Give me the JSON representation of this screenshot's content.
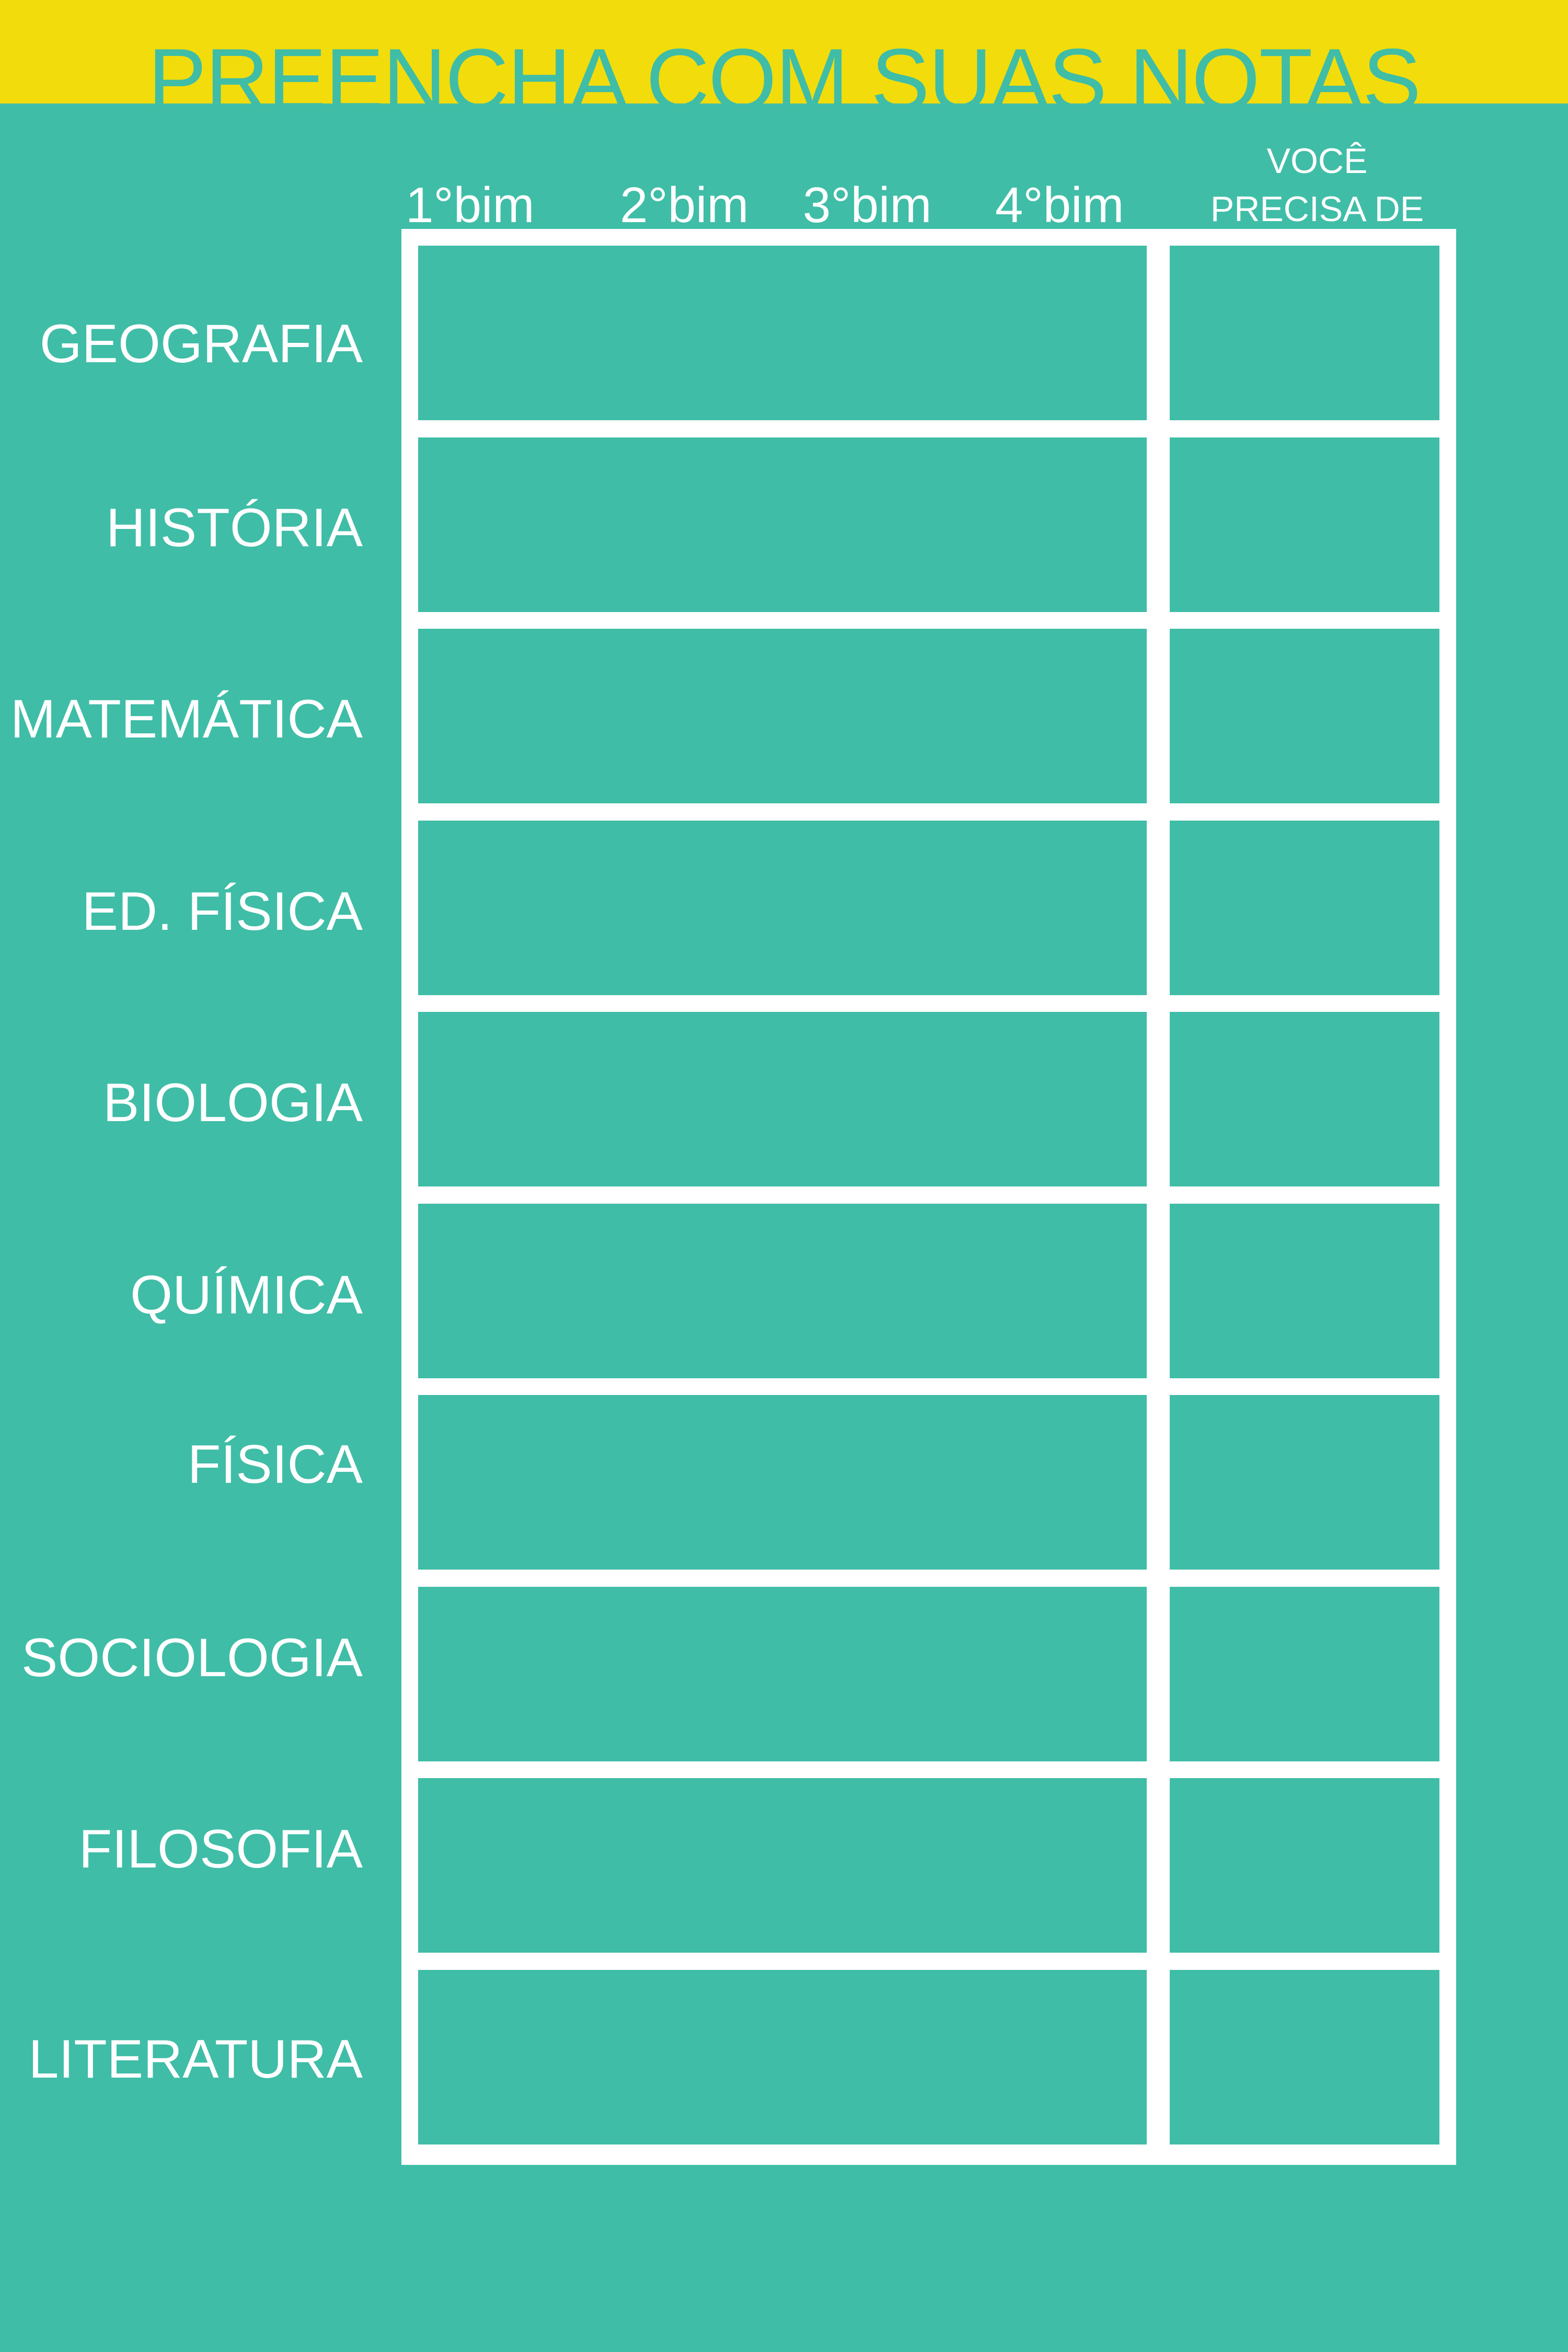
{
  "header": {
    "title": "PREENCHA COM SUAS NOTAS",
    "band_color": "#f3dc0b",
    "background_color": "#3fbda7"
  },
  "columns": {
    "bimesters": [
      "1°bim",
      "2°bim",
      "3°bim",
      "4°bim"
    ],
    "need_line1": "VOCÊ",
    "need_line2": "PRECISA DE"
  },
  "subjects": [
    "GEOGRAFIA",
    "HISTÓRIA",
    "MATEMÁTICA",
    "ED. FÍSICA",
    "BIOLOGIA",
    "QUÍMICA",
    "FÍSICA",
    "SOCIOLOGIA",
    "FILOSOFIA",
    "LITERATURA"
  ]
}
